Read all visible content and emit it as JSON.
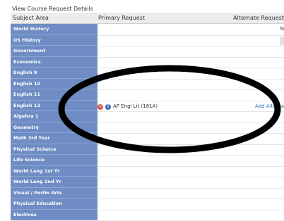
{
  "panel_title": "View Course Request Details",
  "columns": {
    "subject": "Subject Area",
    "primary": "Primary Request",
    "alternate": "Alternate Request"
  },
  "rows": [
    {
      "subject": "World History"
    },
    {
      "subject": "US History"
    },
    {
      "subject": "Government"
    },
    {
      "subject": "Economics"
    },
    {
      "subject": "English 9"
    },
    {
      "subject": "English 10"
    },
    {
      "subject": "English 11"
    },
    {
      "subject": "English 12",
      "primary": "AP Engl Lit (181A)",
      "alternate": "Add Alternate"
    },
    {
      "subject": "Algebra 1"
    },
    {
      "subject": "Geometry"
    },
    {
      "subject": "Math 3rd Year"
    },
    {
      "subject": "Physical Science"
    },
    {
      "subject": "Life Science"
    },
    {
      "subject": "World Lang 1st Yr"
    },
    {
      "subject": "World Lang 2nd Yr"
    },
    {
      "subject": "Visual / Perfm Arts"
    },
    {
      "subject": "Physical Education"
    },
    {
      "subject": "Electives"
    }
  ],
  "edge_text": "N",
  "icons": {
    "remove": "remove-icon",
    "info": "info-icon"
  },
  "colors": {
    "subject_bg": "#6f8dc4",
    "link": "#3a6fb5",
    "remove": "#d9534f"
  }
}
